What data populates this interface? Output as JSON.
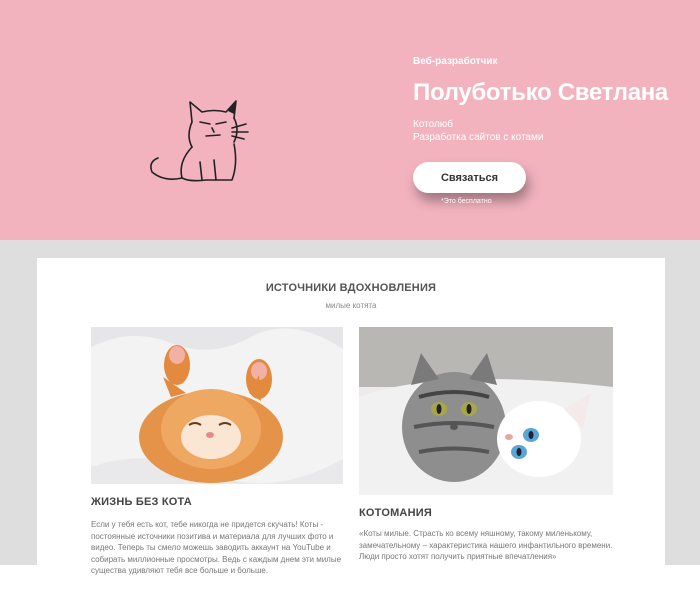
{
  "hero": {
    "role": "Веб-разработчик",
    "name": "Полуботько Светлана",
    "tagline_line1": "Котолюб",
    "tagline_line2": "Разработка сайтов с котами",
    "contact_button": "Связаться",
    "free_note": "*Это бесплатно",
    "background_color": "#f2b3bf"
  },
  "section": {
    "title": "ИСТОЧНИКИ ВДОХНОВЛЕНИЯ",
    "subtitle": "милые котята"
  },
  "columns": [
    {
      "title": "ЖИЗНЬ БЕЗ КОТА",
      "text": "Если у тебя есть кот, тебе никогда не придется скучать! Коты - постоянные источники позитива и материала для лучших фото и видео. Теперь ты смело можешь заводить аккаунт на YouTube и собирать миллионные просмотры. Ведь с каждым днем эти милые существа удивляют тебя все больше и больше."
    },
    {
      "title": "КОТОМАНИЯ",
      "text": "«Коты милые. Страсть ко всему няшному, такому миленькому, замечательному – характеристика нашего инфантильного времени. Люди просто хотят получить приятные впечатления»"
    }
  ]
}
